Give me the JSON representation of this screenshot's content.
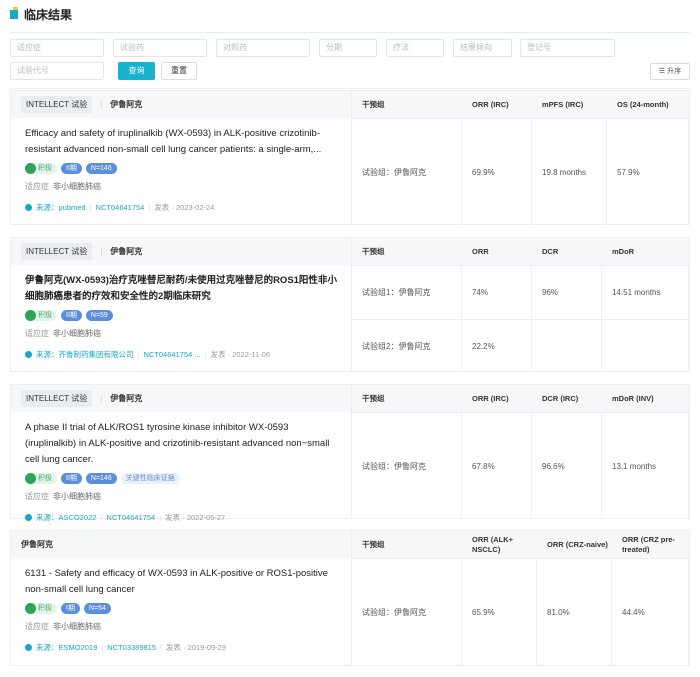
{
  "page": {
    "title": "临床结果"
  },
  "filters": {
    "indication": "适应症",
    "test_drug": "试验药",
    "control_drug": "对照药",
    "phase": "分期",
    "therapy": "疗法",
    "result_trend": "结果倾向",
    "registry": "登记号",
    "trial_code": "试验代号",
    "query": "查询",
    "reset": "重置",
    "sort": "升序"
  },
  "cards": [
    {
      "trial": "INTELLECT 试验",
      "drug": "伊鲁阿克",
      "title": "Efficacy and safety of iruplinalkib (WX-0593) in ALK-positive crizotinib-resistant advanced non-small cell lung cancer patients: a single-arm,...",
      "tags": {
        "trend": "积极",
        "phase": "II期",
        "n": "N=146"
      },
      "indication_label": "适应症",
      "indication": "非小细胞肺癌",
      "source": "来源：pubmed",
      "nct": "NCT04641754",
      "published": "发表 · 2023-02-24",
      "headers": [
        "干预组",
        "ORR (IRC)",
        "mPFS (IRC)",
        "OS (24-month)"
      ],
      "rows": [
        [
          "试验组：伊鲁阿克",
          "69.9%",
          "19.8 months",
          "57.9%"
        ]
      ]
    },
    {
      "trial": "INTELLECT 试验",
      "drug": "伊鲁阿克",
      "title": "伊鲁阿克(WX-0593)治疗克唑替尼耐药/未使用过克唑替尼的ROS1阳性非小细胞肺癌患者的疗效和安全性的2期临床研究",
      "tags": {
        "trend": "积极",
        "phase": "II期",
        "n": "N=59"
      },
      "indication_label": "适应症",
      "indication": "非小细胞肺癌",
      "source": "来源：齐鲁制药集团有限公司",
      "nct": "NCT04641754 ...",
      "published": "发表 · 2022-11-06",
      "headers": [
        "干预组",
        "ORR",
        "DCR",
        "mDoR"
      ],
      "rows": [
        [
          "试验组1：伊鲁阿克",
          "74%",
          "96%",
          "14.51 months"
        ],
        [
          "试验组2：伊鲁阿克",
          "22.2%",
          "",
          ""
        ]
      ]
    },
    {
      "trial": "INTELLECT 试验",
      "drug": "伊鲁阿克",
      "title": "A phase II trial of ALK/ROS1 tyrosine kinase inhibitor WX-0593 (iruplinalkib) in ALK-positive and crizotinib-resistant advanced non−small cell lung cancer.",
      "tags": {
        "trend": "积极",
        "phase": "II期",
        "n": "N=146",
        "key": "关键性临床证据"
      },
      "indication_label": "适应症",
      "indication": "非小细胞肺癌",
      "source": "来源：ASCO2022",
      "nct": "NCT04641754",
      "published": "发表 · 2022-05-27",
      "headers": [
        "干预组",
        "ORR (IRC)",
        "DCR (IRC)",
        "mDoR (INV)"
      ],
      "rows": [
        [
          "试验组：伊鲁阿克",
          "67.8%",
          "96.6%",
          "13.1 months"
        ]
      ]
    },
    {
      "drug": "伊鲁阿克",
      "title": "6131 - Safety and efficacy of WX-0593 in ALK-positive or ROS1-positive non-small cell lung cancer",
      "tags": {
        "trend": "积极",
        "phase": "I期",
        "n": "N=54"
      },
      "indication_label": "适应症",
      "indication": "非小细胞肺癌",
      "source": "来源：ESMO2019",
      "nct": "NCT03389815",
      "published": "发表 · 2019-09-29",
      "headers": [
        "干预组",
        "ORR (ALK+ NSCLC)",
        "ORR (CRZ-naive)",
        "ORR (CRZ pre-treated)"
      ],
      "rows": [
        [
          "试验组：伊鲁阿克",
          "65.9%",
          "81.0%",
          "44.4%"
        ]
      ]
    }
  ]
}
